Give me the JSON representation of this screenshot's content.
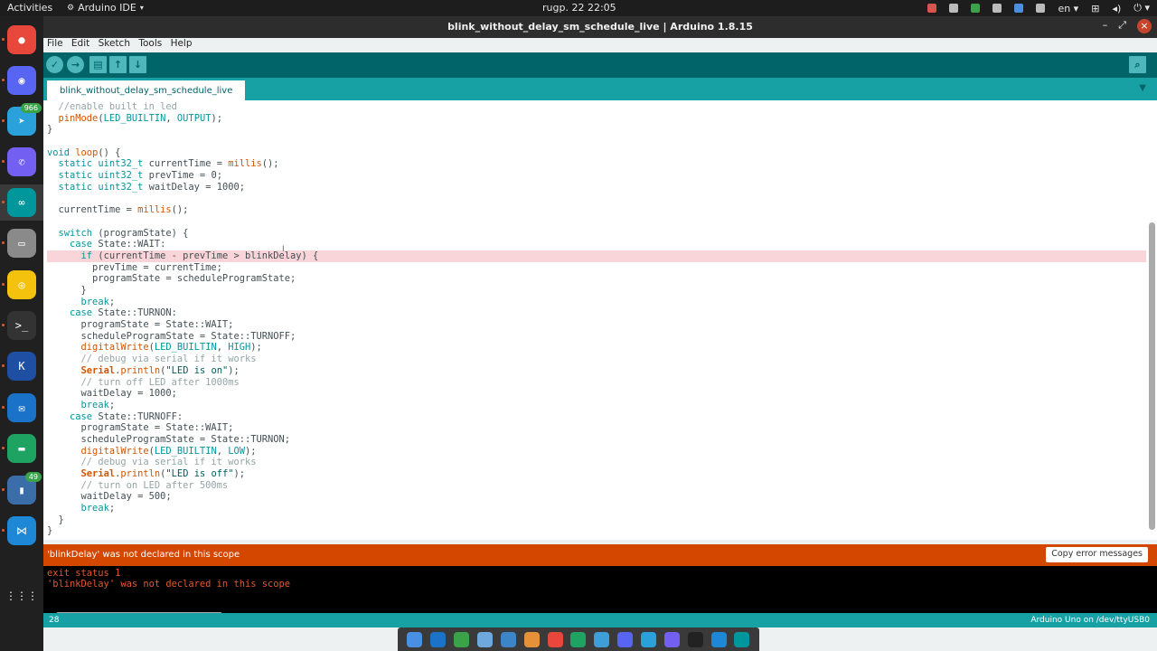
{
  "topbar": {
    "activities": "Activities",
    "app_name": "Arduino IDE",
    "clock": "rugp. 22  22:05",
    "lang": "en"
  },
  "dock": {
    "items": [
      {
        "name": "chrome-icon",
        "color": "#e8473b",
        "glyph": "●"
      },
      {
        "name": "discord-icon",
        "color": "#5865f2",
        "glyph": "◉"
      },
      {
        "name": "telegram-icon",
        "color": "#2aa1da",
        "glyph": "➤",
        "badge": "966"
      },
      {
        "name": "viber-icon",
        "color": "#7360f2",
        "glyph": "✆"
      },
      {
        "name": "arduino-icon",
        "color": "#00979c",
        "glyph": "∞"
      },
      {
        "name": "files-icon",
        "color": "#8a8a8a",
        "glyph": "▭"
      },
      {
        "name": "rhythmbox-icon",
        "color": "#f4c20d",
        "glyph": "◎"
      },
      {
        "name": "terminal-icon",
        "color": "#333333",
        "glyph": ">_"
      },
      {
        "name": "klogg-icon",
        "color": "#1f4fa3",
        "glyph": "K"
      },
      {
        "name": "thunderbird-icon",
        "color": "#1a73c9",
        "glyph": "✉"
      },
      {
        "name": "chat-icon",
        "color": "#1ea362",
        "glyph": "▬"
      },
      {
        "name": "notes-icon",
        "color": "#3b6ea8",
        "glyph": "▮",
        "badge": "49"
      },
      {
        "name": "vscode-icon",
        "color": "#1e88d6",
        "glyph": "⋈"
      },
      {
        "name": "show-apps-icon",
        "color": "#202020",
        "glyph": "⋮⋮⋮"
      }
    ]
  },
  "window": {
    "title": "blink_without_delay_sm_schedule_live | Arduino 1.8.15",
    "minimize": "–",
    "maximize": "⤢",
    "close": "×"
  },
  "menu": [
    "File",
    "Edit",
    "Sketch",
    "Tools",
    "Help"
  ],
  "toolbar": {
    "verify": "✓",
    "upload": "→",
    "new": "▤",
    "open": "↑",
    "save": "↓",
    "serial_monitor": "⌕"
  },
  "tab": {
    "label": "blink_without_delay_sm_schedule_live",
    "menu": "▼"
  },
  "code_lines": [
    "  //enable built in led",
    "  pinMode(LED_BUILTIN, OUTPUT);",
    "}",
    "",
    "void loop() {",
    "  static uint32_t currentTime = millis();",
    "  static uint32_t prevTime = 0;",
    "  static uint32_t waitDelay = 1000;",
    "",
    "  currentTime = millis();",
    "",
    "  switch (programState) {",
    "    case State::WAIT:",
    "      if (currentTime - prevTime > blinkDelay) {",
    "        prevTime = currentTime;",
    "        programState = scheduleProgramState;",
    "      }",
    "      break;",
    "    case State::TURNON:",
    "      programState = State::WAIT;",
    "      scheduleProgramState = State::TURNOFF;",
    "      digitalWrite(LED_BUILTIN, HIGH);",
    "      // debug via serial if it works",
    "      Serial.println(\"LED is on\");",
    "      // turn off LED after 1000ms",
    "      waitDelay = 1000;",
    "      break;",
    "    case State::TURNOFF:",
    "      programState = State::WAIT;",
    "      scheduleProgramState = State::TURNON;",
    "      digitalWrite(LED_BUILTIN, LOW);",
    "      // debug via serial if it works",
    "      Serial.println(\"LED is off\");",
    "      // turn on LED after 500ms",
    "      waitDelay = 500;",
    "      break;",
    "  }",
    "}"
  ],
  "error_line_index": 13,
  "status": {
    "error_message": "'blinkDelay' was not declared in this scope",
    "copy_button": "Copy error messages"
  },
  "console_lines": [
    "exit status 1",
    "'blinkDelay' was not declared in this scope"
  ],
  "statusbar": {
    "line_number": "28",
    "board": "Arduino Uno on /dev/ttyUSB0"
  },
  "taskbar": {
    "icons": [
      {
        "name": "notes-task-icon",
        "color": "#4a90e2"
      },
      {
        "name": "thunderbird-task-icon",
        "color": "#1a73c9"
      },
      {
        "name": "arduino-task-icon",
        "color": "#3aa34a"
      },
      {
        "name": "phone-task-icon",
        "color": "#6fa8dc"
      },
      {
        "name": "files-task-icon",
        "color": "#3d85c6"
      },
      {
        "name": "calendar-task-icon",
        "color": "#e69138"
      },
      {
        "name": "chrome-task-icon",
        "color": "#e8473b"
      },
      {
        "name": "chat-task-icon",
        "color": "#1ea362"
      },
      {
        "name": "maps-task-icon",
        "color": "#3f9dd8"
      },
      {
        "name": "discord-task-icon",
        "color": "#5865f2"
      },
      {
        "name": "telegram-task-icon",
        "color": "#2aa1da"
      },
      {
        "name": "viber-task-icon",
        "color": "#7360f2"
      },
      {
        "name": "terminal-task-icon",
        "color": "#222222"
      },
      {
        "name": "vscode-task-icon",
        "color": "#1e88d6"
      },
      {
        "name": "arduino-ide-task-icon",
        "color": "#00979c"
      }
    ]
  }
}
